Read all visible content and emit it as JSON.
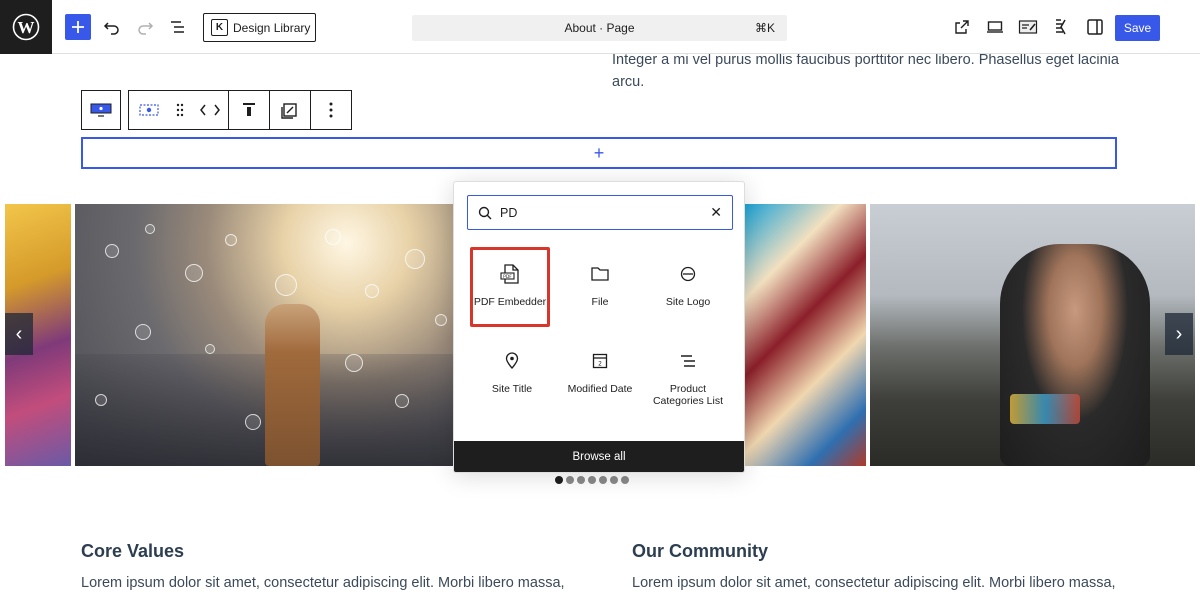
{
  "toolbar": {
    "design_library_label": "Design Library",
    "command_title": "About · Page",
    "command_shortcut": "⌘K",
    "save_label": "Save"
  },
  "page": {
    "intro_text": "Integer a mi vel purus mollis faucibus porttitor nec libero. Phasellus eget lacinia arcu.",
    "appender_symbol": "+",
    "sections": [
      {
        "title": "Core Values",
        "text": "Lorem ipsum dolor sit amet, consectetur adipiscing elit. Morbi libero massa,"
      },
      {
        "title": "Our Community",
        "text": "Lorem ipsum dolor sit amet, consectetur adipiscing elit. Morbi libero massa,"
      }
    ]
  },
  "slider": {
    "prev_arrow": "‹",
    "next_arrow": "›",
    "dot_count": 7,
    "active_dot": 0
  },
  "inserter": {
    "search_value": "PD",
    "clear_symbol": "✕",
    "blocks": [
      {
        "label": "PDF Embedder",
        "icon": "pdf-icon"
      },
      {
        "label": "File",
        "icon": "folder-icon"
      },
      {
        "label": "Site Logo",
        "icon": "site-logo-icon"
      },
      {
        "label": "Site Title",
        "icon": "map-marker-icon"
      },
      {
        "label": "Modified Date",
        "icon": "calendar-icon"
      },
      {
        "label": "Product Categories List",
        "icon": "list-icon"
      }
    ],
    "browse_all_label": "Browse all"
  },
  "colors": {
    "accent": "#3858e9",
    "highlight": "#d9362b",
    "dark": "#1e1e1e"
  }
}
